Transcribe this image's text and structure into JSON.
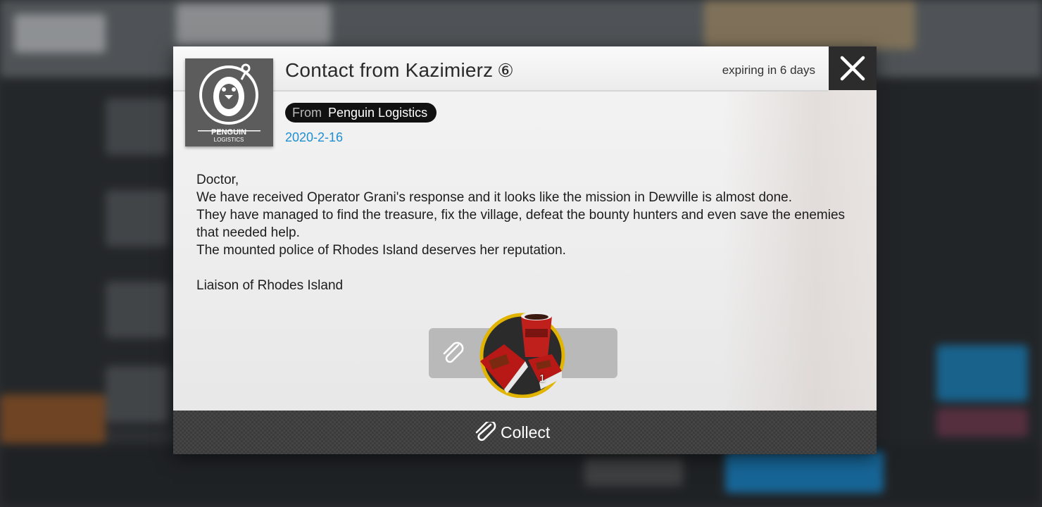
{
  "mail": {
    "title": "Contact from Kazimierz",
    "mail_count": "⑥",
    "expiry": "expiring in 6 days",
    "from_label": "From",
    "sender": "Penguin Logistics",
    "date": "2020-2-16",
    "sender_logo_text": "PENGUIN",
    "sender_logo_subtext": "LOGISTICS",
    "body_lines": [
      "Doctor,",
      "We have received Operator Grani's response and it looks like the mission in Dewville is almost done.",
      "They have managed to find the treasure, fix the village, defeat the bounty hunters and even save the enemies that needed help.",
      "The mounted police of Rhodes Island deserves her reputation.",
      "",
      "Liaison of Rhodes Island"
    ]
  },
  "attachment": {
    "icon": "paperclip-icon",
    "item_icon": "food-combo-icon",
    "item_count": "1"
  },
  "actions": {
    "collect_label": "Collect",
    "close_icon": "close-icon"
  },
  "colors": {
    "date": "#1f8fd0",
    "header_close_bg": "#2c2c2c",
    "collect_bar_bg": "#3b3b3b",
    "from_badge_bg": "#111111"
  }
}
